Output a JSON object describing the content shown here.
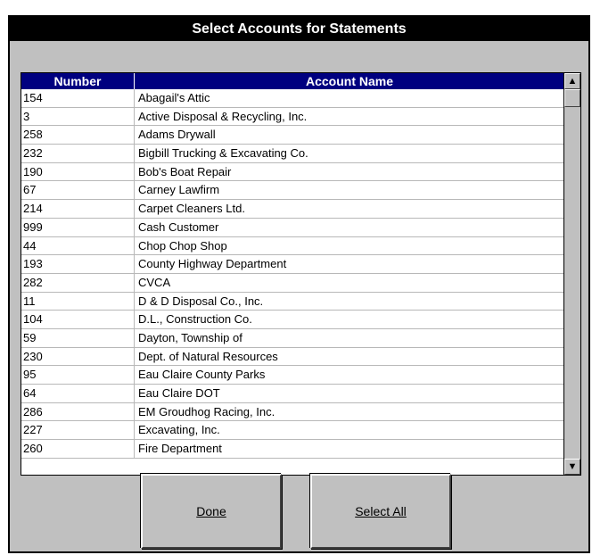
{
  "window": {
    "title": "Select Accounts for Statements"
  },
  "list": {
    "columns": {
      "number": "Number",
      "name": "Account Name"
    },
    "rows": [
      {
        "number": "154",
        "name": "Abagail's Attic"
      },
      {
        "number": "3",
        "name": "Active Disposal & Recycling, Inc."
      },
      {
        "number": "258",
        "name": "Adams Drywall"
      },
      {
        "number": "232",
        "name": "Bigbill Trucking & Excavating Co."
      },
      {
        "number": "190",
        "name": "Bob's Boat Repair"
      },
      {
        "number": "67",
        "name": "Carney Lawfirm"
      },
      {
        "number": "214",
        "name": "Carpet Cleaners Ltd."
      },
      {
        "number": "999",
        "name": "Cash Customer"
      },
      {
        "number": "44",
        "name": "Chop Chop Shop"
      },
      {
        "number": "193",
        "name": "County Highway Department"
      },
      {
        "number": "282",
        "name": "CVCA"
      },
      {
        "number": "11",
        "name": "D & D Disposal Co., Inc."
      },
      {
        "number": "104",
        "name": "D.L., Construction Co."
      },
      {
        "number": "59",
        "name": "Dayton, Township of"
      },
      {
        "number": "230",
        "name": "Dept. of Natural Resources"
      },
      {
        "number": "95",
        "name": "Eau Claire County Parks"
      },
      {
        "number": "64",
        "name": "Eau Claire DOT"
      },
      {
        "number": "286",
        "name": "EM Groudhog Racing, Inc."
      },
      {
        "number": "227",
        "name": "Excavating, Inc."
      },
      {
        "number": "260",
        "name": "Fire Department"
      }
    ]
  },
  "scrollbar": {
    "up_arrow": "▲",
    "down_arrow": "▼"
  },
  "buttons": {
    "done": "Done",
    "select_all": "Select All"
  }
}
